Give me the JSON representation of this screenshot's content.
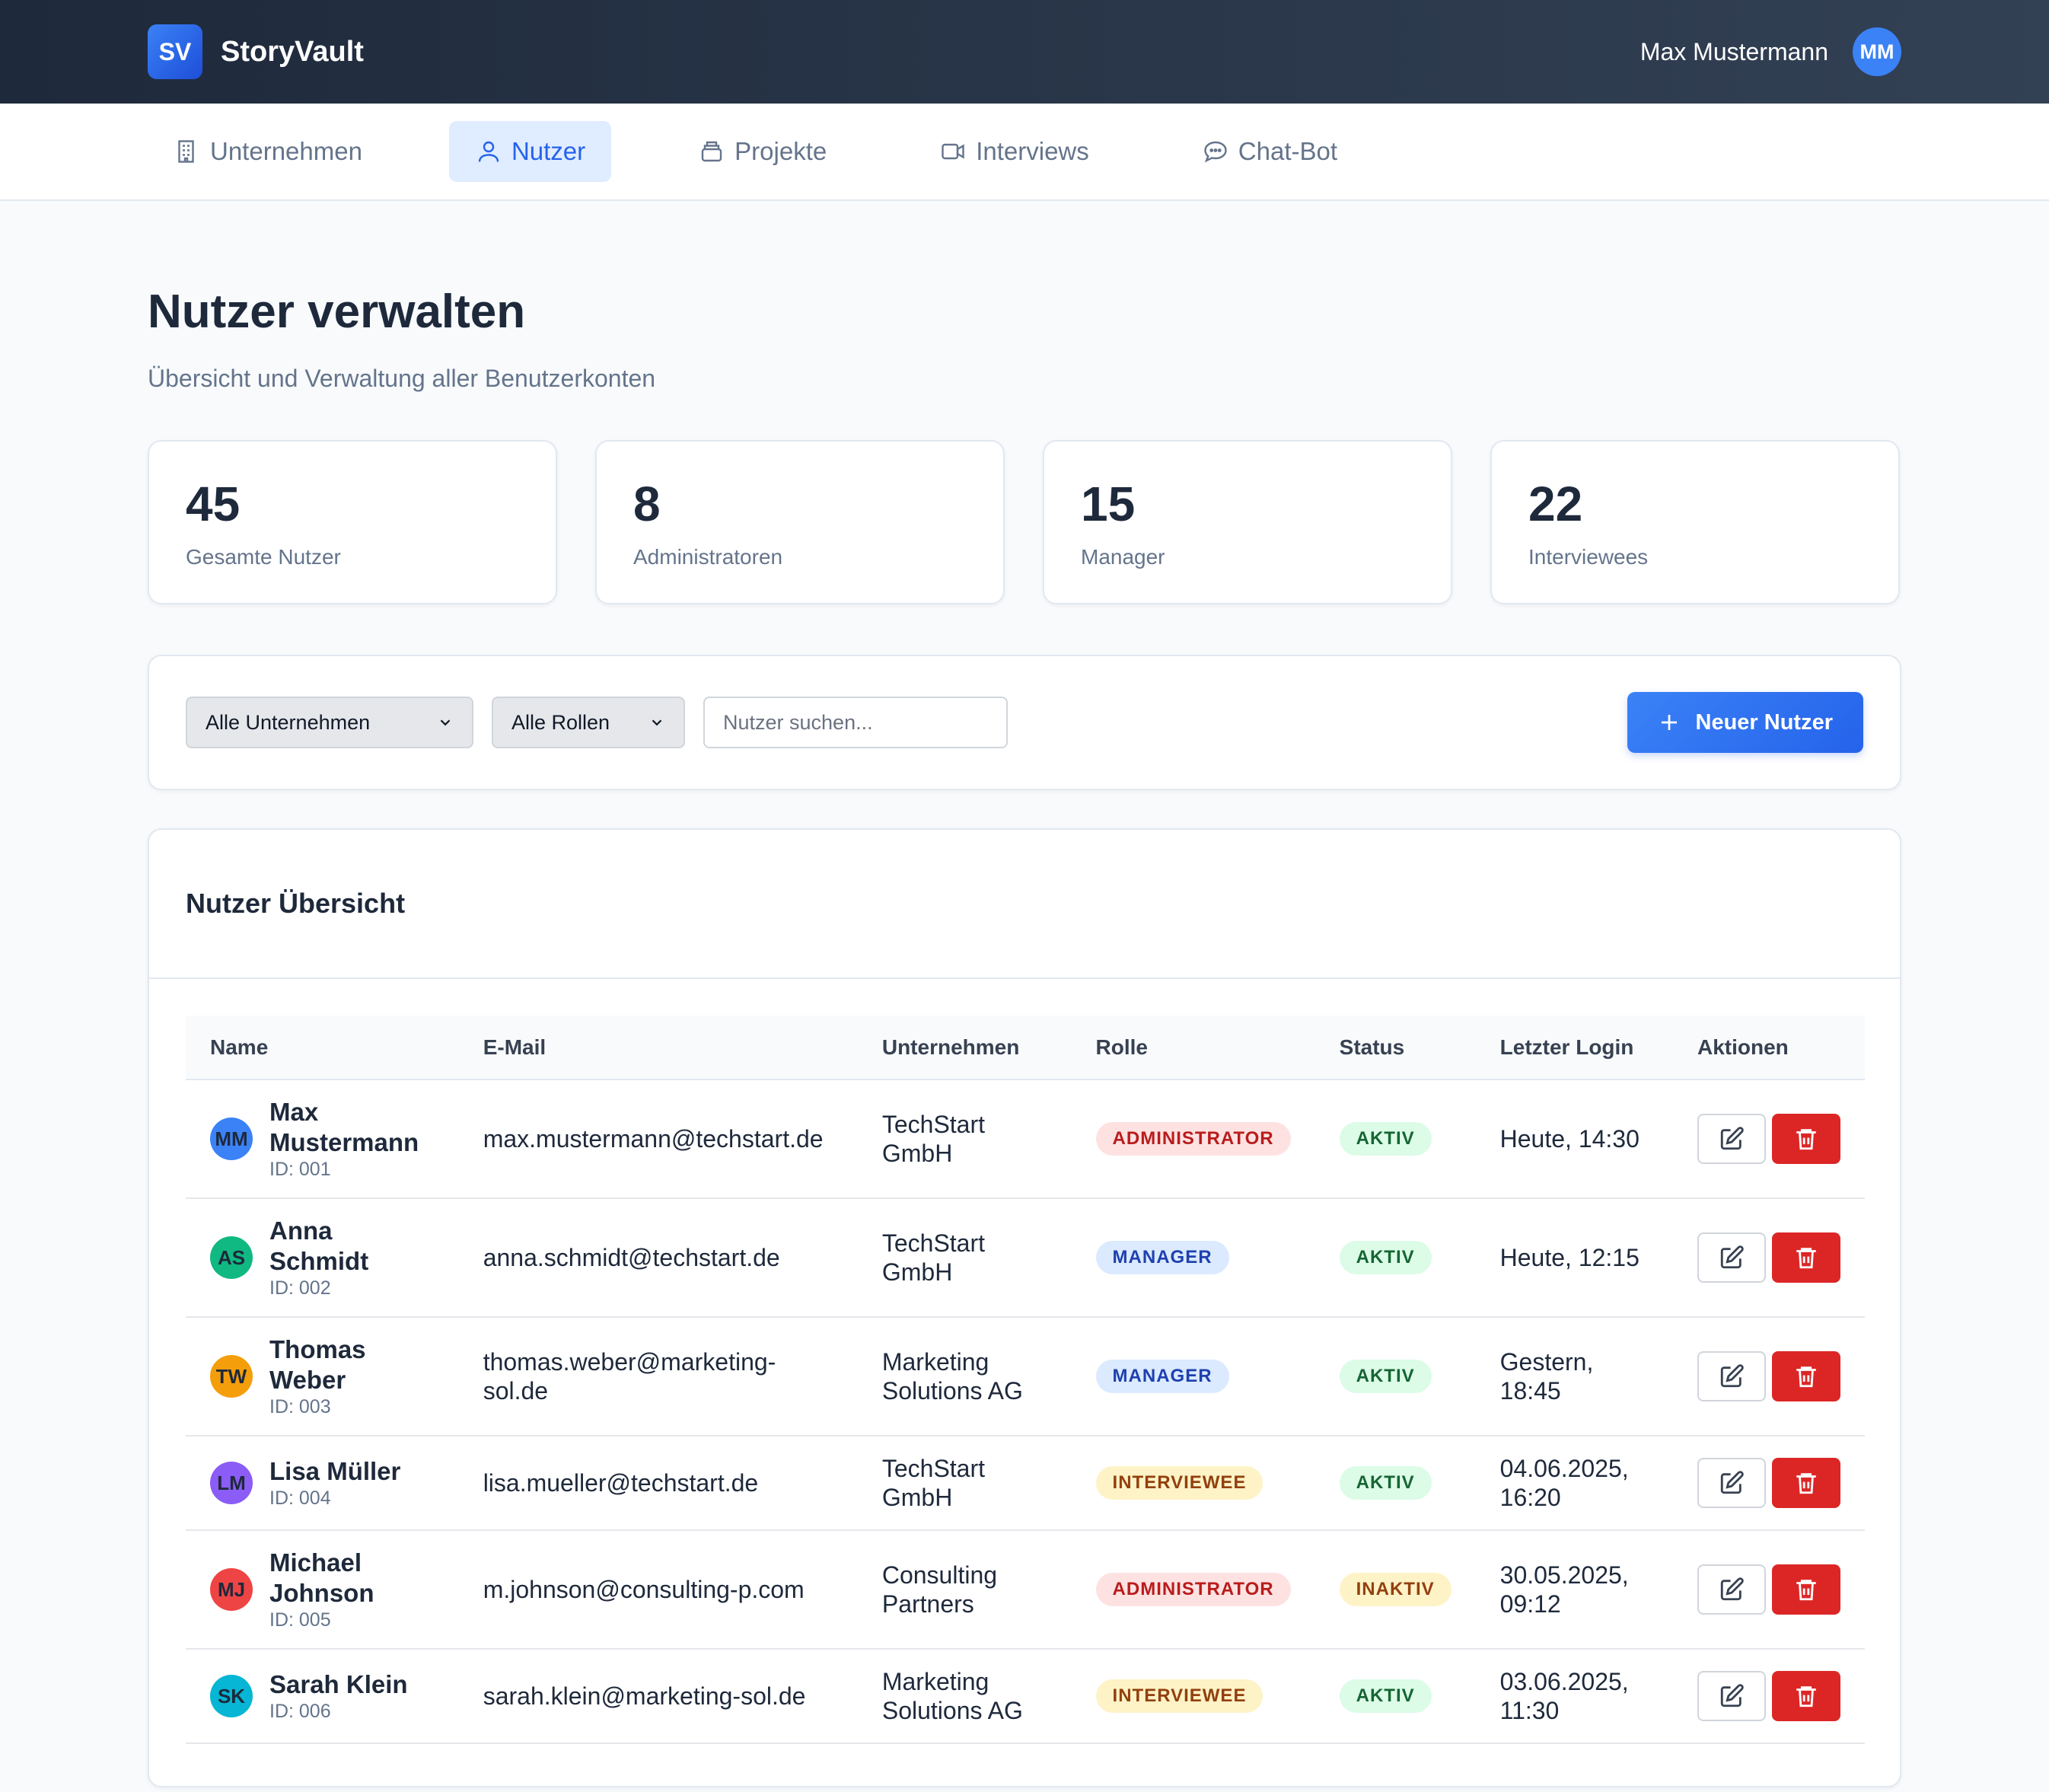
{
  "app": {
    "logo_text": "SV",
    "name": "StoryVault"
  },
  "user": {
    "name": "Max Mustermann",
    "initials": "MM"
  },
  "nav": {
    "tabs": [
      {
        "label": "Unternehmen",
        "icon": "building-icon"
      },
      {
        "label": "Nutzer",
        "icon": "user-icon",
        "active": true
      },
      {
        "label": "Projekte",
        "icon": "folder-stack-icon"
      },
      {
        "label": "Interviews",
        "icon": "video-icon"
      },
      {
        "label": "Chat-Bot",
        "icon": "chat-bubble-icon"
      }
    ]
  },
  "page": {
    "title": "Nutzer verwalten",
    "subtitle": "Übersicht und Verwaltung aller Benutzerkonten"
  },
  "stats": [
    {
      "value": "45",
      "label": "Gesamte Nutzer"
    },
    {
      "value": "8",
      "label": "Administratoren"
    },
    {
      "value": "15",
      "label": "Manager"
    },
    {
      "value": "22",
      "label": "Interviewees"
    }
  ],
  "filters": {
    "company_select": "Alle Unternehmen",
    "role_select": "Alle Rollen",
    "search_placeholder": "Nutzer suchen...",
    "add_button": "Neuer Nutzer"
  },
  "table": {
    "title": "Nutzer Übersicht",
    "columns": [
      "Name",
      "E-Mail",
      "Unternehmen",
      "Rolle",
      "Status",
      "Letzter Login",
      "Aktionen"
    ],
    "rows": [
      {
        "initials": "MM",
        "name_l1": "Max",
        "name_l2": "Mustermann",
        "id": "ID: 001",
        "email": "max.mustermann@techstart.de",
        "company_l1": "TechStart",
        "company_l2": "GmbH",
        "role": "ADMINISTRATOR",
        "status": "AKTIV",
        "login_l1": "Heute, 14:30",
        "login_l2": ""
      },
      {
        "initials": "AS",
        "name_l1": "Anna",
        "name_l2": "Schmidt",
        "id": "ID: 002",
        "email": "anna.schmidt@techstart.de",
        "company_l1": "TechStart",
        "company_l2": "GmbH",
        "role": "MANAGER",
        "status": "AKTIV",
        "login_l1": "Heute, 12:15",
        "login_l2": ""
      },
      {
        "initials": "TW",
        "name_l1": "Thomas",
        "name_l2": "Weber",
        "id": "ID: 003",
        "email": "thomas.weber@marketing-",
        "email_l2": "sol.de",
        "company_l1": "Marketing",
        "company_l2": "Solutions AG",
        "role": "MANAGER",
        "status": "AKTIV",
        "login_l1": "Gestern,",
        "login_l2": "18:45"
      },
      {
        "initials": "LM",
        "name_l1": "Lisa Müller",
        "name_l2": "",
        "id": "ID: 004",
        "email": "lisa.mueller@techstart.de",
        "company_l1": "TechStart",
        "company_l2": "GmbH",
        "role": "INTERVIEWEE",
        "status": "AKTIV",
        "login_l1": "04.06.2025,",
        "login_l2": "16:20"
      },
      {
        "initials": "MJ",
        "name_l1": "Michael",
        "name_l2": "Johnson",
        "id": "ID: 005",
        "email": "m.johnson@consulting-p.com",
        "company_l1": "Consulting",
        "company_l2": "Partners",
        "role": "ADMINISTRATOR",
        "status": "INAKTIV",
        "login_l1": "30.05.2025,",
        "login_l2": "09:12"
      },
      {
        "initials": "SK",
        "name_l1": "Sarah Klein",
        "name_l2": "",
        "id": "ID: 006",
        "email": "sarah.klein@marketing-sol.de",
        "company_l1": "Marketing",
        "company_l2": "Solutions AG",
        "role": "INTERVIEWEE",
        "status": "AKTIV",
        "login_l1": "03.06.2025,",
        "login_l2": "11:30"
      }
    ]
  },
  "colors": {
    "primary": "#2563eb",
    "danger": "#dc2626",
    "header_bg": "#1e293b"
  }
}
